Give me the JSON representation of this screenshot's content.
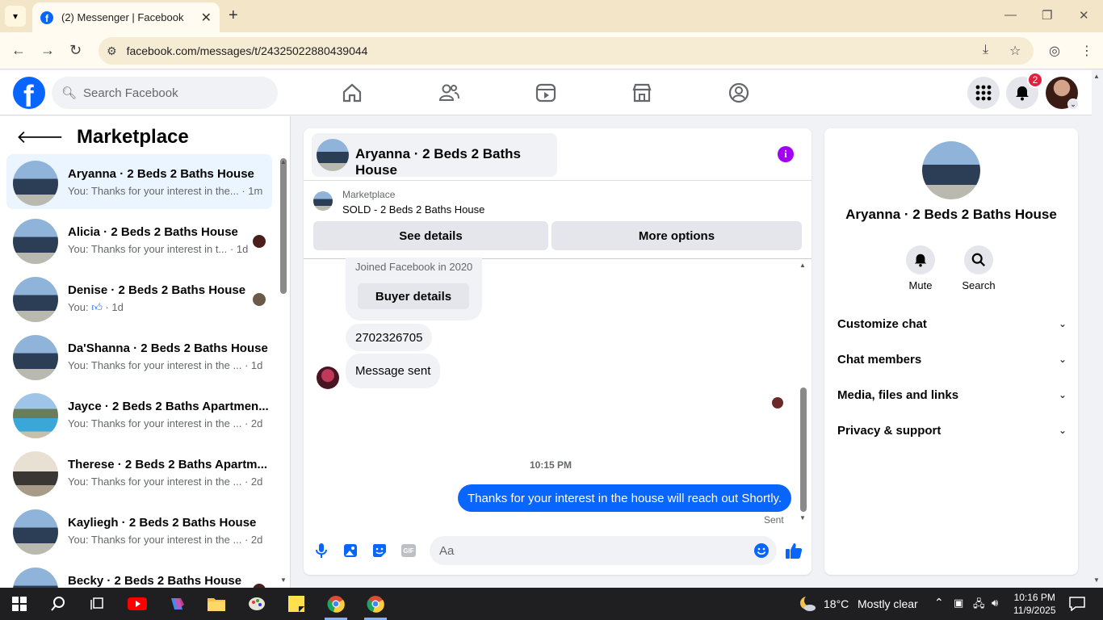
{
  "browser": {
    "tab_title": "(2) Messenger | Facebook",
    "url": "facebook.com/messages/t/24325022880439044"
  },
  "header": {
    "search_placeholder": "Search Facebook",
    "notification_count": "2",
    "logo_letter": "f"
  },
  "sidebar": {
    "title": "Marketplace",
    "conversations": [
      {
        "name": "Aryanna · 2 Beds 2 Baths House",
        "preview": "You: Thanks for your interest in the...",
        "time": "1m",
        "thumb": "house"
      },
      {
        "name": "Alicia · 2 Beds 2 Baths House",
        "preview": "You: Thanks for your interest in t...",
        "time": "1d",
        "thumb": "house"
      },
      {
        "name": "Denise · 2 Beds 2 Baths House",
        "preview": "You:",
        "time": "1d",
        "thumb": "house"
      },
      {
        "name": "Da'Shanna · 2 Beds 2 Baths House",
        "preview": "You: Thanks for your interest in the ...",
        "time": "1d",
        "thumb": "house"
      },
      {
        "name": "Jayce · 2 Beds 2 Baths Apartmen...",
        "preview": "You: Thanks for your interest in the ...",
        "time": "2d",
        "thumb": "pool"
      },
      {
        "name": "Therese · 2 Beds 2 Baths Apartm...",
        "preview": "You: Thanks for your interest in the ...",
        "time": "2d",
        "thumb": "interior"
      },
      {
        "name": "Kayliegh · 2 Beds 2 Baths House",
        "preview": "You: Thanks for your interest in the ...",
        "time": "2d",
        "thumb": "house"
      },
      {
        "name": "Becky · 2 Beds 2 Baths House",
        "preview": "",
        "time": "",
        "thumb": "house"
      }
    ]
  },
  "chat": {
    "title": "Aryanna · 2 Beds 2 Baths House",
    "marketplace_label": "Marketplace",
    "listing_title": "SOLD - 2 Beds 2 Baths House",
    "see_details": "See details",
    "more_options": "More options",
    "joined_text": "Joined Facebook in 2020",
    "buyer_details": "Buyer details",
    "messages": {
      "phone": "2702326705",
      "message_sent": "Message sent",
      "outgoing": "Thanks for your interest in the house will reach out Shortly."
    },
    "timestamp": "10:15 PM",
    "status": "Sent",
    "composer_placeholder": "Aa"
  },
  "info_panel": {
    "name": "Aryanna · 2 Beds 2 Baths House",
    "mute_label": "Mute",
    "search_label": "Search",
    "sections": [
      "Customize chat",
      "Chat members",
      "Media, files and links",
      "Privacy & support"
    ]
  },
  "taskbar": {
    "weather_temp": "18°C",
    "weather_desc": "Mostly clear",
    "time": "10:16 PM",
    "date": "11/9/2025"
  },
  "colors": {
    "accent": "#0866ff",
    "info_icon": "#a100f2",
    "badge": "#e41e3f"
  }
}
